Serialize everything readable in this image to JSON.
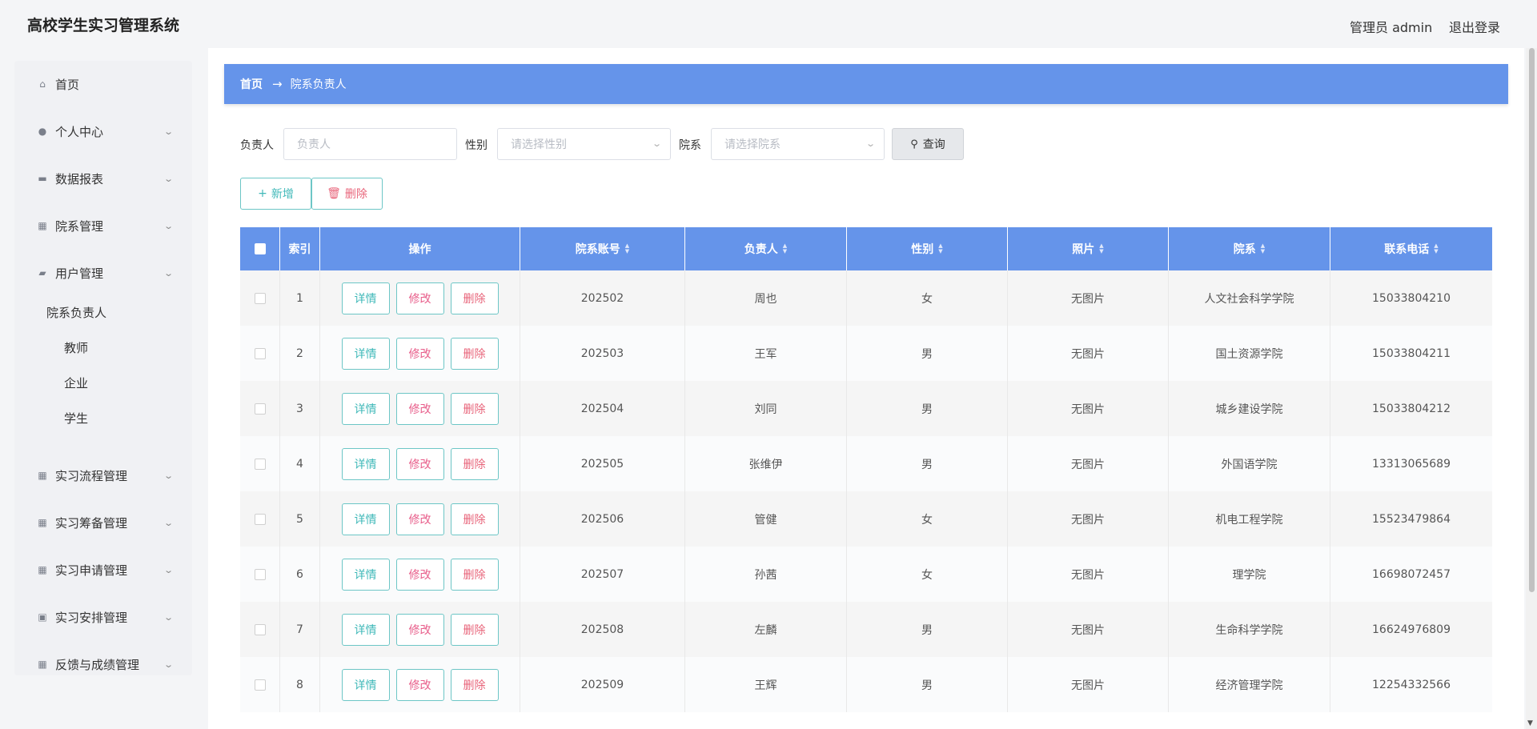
{
  "app": {
    "title": "高校学生实习管理系统",
    "admin": "管理员 admin",
    "logout": "退出登录"
  },
  "sidebar": {
    "items": [
      {
        "label": "首页",
        "icon": "home-icon",
        "glyph": "⌂",
        "chevron": false
      },
      {
        "label": "个人中心",
        "icon": "user-icon",
        "glyph": "●",
        "chevron": true
      },
      {
        "label": "数据报表",
        "icon": "monitor-icon",
        "glyph": "▬",
        "chevron": true
      },
      {
        "label": "院系管理",
        "icon": "grid-icon",
        "glyph": "▦",
        "chevron": true
      },
      {
        "label": "用户管理",
        "icon": "chat-icon",
        "glyph": "▰",
        "chevron": true,
        "expanded": true
      },
      {
        "label": "实习流程管理",
        "icon": "grid-icon",
        "glyph": "▦",
        "chevron": true
      },
      {
        "label": "实习筹备管理",
        "icon": "grid-icon",
        "glyph": "▦",
        "chevron": true
      },
      {
        "label": "实习申请管理",
        "icon": "grid-icon",
        "glyph": "▦",
        "chevron": true
      },
      {
        "label": "实习安排管理",
        "icon": "briefcase-icon",
        "glyph": "▣",
        "chevron": true
      },
      {
        "label": "反馈与成绩管理",
        "icon": "grid-icon",
        "glyph": "▦",
        "chevron": true
      }
    ],
    "sub_items": [
      "院系负责人",
      "教师",
      "企业",
      "学生"
    ]
  },
  "breadcrumb": {
    "home": "首页",
    "arrow": "→",
    "current": "院系负责人"
  },
  "search": {
    "person_label": "负责人",
    "person_placeholder": "负责人",
    "gender_label": "性别",
    "gender_placeholder": "请选择性别",
    "dept_label": "院系",
    "dept_placeholder": "请选择院系",
    "query_label": "查询"
  },
  "actions": {
    "add_label": "新增",
    "delete_label": "删除"
  },
  "table": {
    "headers": [
      "索引",
      "操作",
      "院系账号",
      "负责人",
      "性别",
      "照片",
      "院系",
      "联系电话"
    ],
    "op_labels": {
      "detail": "详情",
      "edit": "修改",
      "delete": "删除"
    },
    "rows": [
      {
        "index": "1",
        "account": "202502",
        "name": "周也",
        "gender": "女",
        "photo": "无图片",
        "dept": "人文社会科学学院",
        "phone": "15033804210"
      },
      {
        "index": "2",
        "account": "202503",
        "name": "王军",
        "gender": "男",
        "photo": "无图片",
        "dept": "国土资源学院",
        "phone": "15033804211"
      },
      {
        "index": "3",
        "account": "202504",
        "name": "刘同",
        "gender": "男",
        "photo": "无图片",
        "dept": "城乡建设学院",
        "phone": "15033804212"
      },
      {
        "index": "4",
        "account": "202505",
        "name": "张维伊",
        "gender": "男",
        "photo": "无图片",
        "dept": "外国语学院",
        "phone": "13313065689"
      },
      {
        "index": "5",
        "account": "202506",
        "name": "管健",
        "gender": "女",
        "photo": "无图片",
        "dept": "机电工程学院",
        "phone": "15523479864"
      },
      {
        "index": "6",
        "account": "202507",
        "name": "孙茜",
        "gender": "女",
        "photo": "无图片",
        "dept": "理学院",
        "phone": "16698072457"
      },
      {
        "index": "7",
        "account": "202508",
        "name": "左麟",
        "gender": "男",
        "photo": "无图片",
        "dept": "生命科学学院",
        "phone": "16624976809"
      },
      {
        "index": "8",
        "account": "202509",
        "name": "王辉",
        "gender": "男",
        "photo": "无图片",
        "dept": "经济管理学院",
        "phone": "12254332566"
      }
    ]
  },
  "colors": {
    "accent": "#6594ea",
    "teal": "#3fb8b8",
    "pink": "#e85d8a",
    "red": "#e8647a"
  }
}
